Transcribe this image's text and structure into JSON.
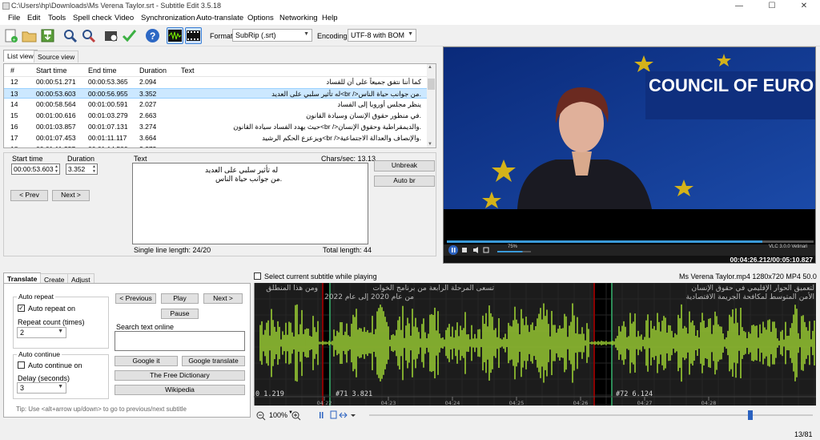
{
  "window": {
    "title": "C:\\Users\\hp\\Downloads\\Ms Verena Taylor.srt - Subtitle Edit 3.5.18",
    "minimize": "—",
    "maximize": "☐",
    "close": "✕"
  },
  "menu": [
    "File",
    "Edit",
    "Tools",
    "Spell check",
    "Video",
    "Synchronization",
    "Auto-translate",
    "Options",
    "Networking",
    "Help"
  ],
  "toolbar": {
    "format_label": "Format",
    "format_value": "SubRip (.srt)",
    "encoding_label": "Encoding",
    "encoding_value": "UTF-8 with BOM",
    "icons": [
      "new-file-icon",
      "open-folder-icon",
      "save-icon",
      "find-icon",
      "replace-icon",
      "visual-sync-icon",
      "spell-check-icon",
      "help-icon",
      "waveform-toggle-icon",
      "video-toggle-icon"
    ]
  },
  "list_tabs": [
    "List view",
    "Source view"
  ],
  "list": {
    "columns": [
      "#",
      "Start time",
      "End time",
      "Duration",
      "Text"
    ],
    "rows": [
      {
        "n": "12",
        "start": "00:00:51.271",
        "end": "00:00:53.365",
        "dur": "2.094",
        "text": "كما أننا نتفق جميعاً على أن للفساد"
      },
      {
        "n": "13",
        "start": "00:00:53.603",
        "end": "00:00:56.955",
        "dur": "3.352",
        "text": "له تأثير سلبي على العديد<br />من جوانب حياة الناس.",
        "selected": true
      },
      {
        "n": "14",
        "start": "00:00:58.564",
        "end": "00:01:00.591",
        "dur": "2.027",
        "text": "ينظر مجلس أوروبا إلى الفساد"
      },
      {
        "n": "15",
        "start": "00:01:00.616",
        "end": "00:01:03.279",
        "dur": "2.663",
        "text": "في منظور حقوق الإنسان وسيادة القانون."
      },
      {
        "n": "16",
        "start": "00:01:03.857",
        "end": "00:01:07.131",
        "dur": "3.274",
        "text": "حيث يهدد الفساد سيادة القانون<br />والديمقراطية وحقوق الإنسان."
      },
      {
        "n": "17",
        "start": "00:01:07.453",
        "end": "00:01:11.117",
        "dur": "3.664",
        "text": "ويزعزع الحكم الرشيد<br />والإنصاف والعدالة الاجتماعية."
      },
      {
        "n": "18",
        "start": "00:01:11.227",
        "end": "00:01:14.500",
        "dur": "3.273",
        "text": ""
      }
    ]
  },
  "edit": {
    "start_label": "Start time",
    "start_value": "00:00:53.603",
    "duration_label": "Duration",
    "duration_value": "3.352",
    "text_label": "Text",
    "chars_sec": "Chars/sec: 13.13",
    "text_line1": "له تأثير سلبي على العديد",
    "text_line2": "من جوانب حياة الناس.",
    "prev_btn": "< Prev",
    "next_btn": "Next >",
    "unbreak_btn": "Unbreak",
    "autobr_btn": "Auto br",
    "single_line": "Single line length: 24/20",
    "total_length": "Total length: 44"
  },
  "video": {
    "banner": "COUNCIL OF EURO",
    "vlc": "VLC 3.0.0 Vetinari",
    "volume": "75%",
    "position": "00:04:26.212",
    "duration": "00:05:10.827",
    "separator": "/",
    "progress": 0.86,
    "volume_level": 0.75
  },
  "bottom_tabs": [
    "Translate",
    "Create",
    "Adjust"
  ],
  "translate": {
    "auto_repeat_title": "Auto repeat",
    "auto_repeat_on": "Auto repeat on",
    "repeat_count_label": "Repeat count (times)",
    "repeat_count_value": "2",
    "auto_continue_title": "Auto continue",
    "auto_continue_on": "Auto continue on",
    "delay_label": "Delay (seconds)",
    "delay_value": "3",
    "previous_btn": "< Previous",
    "play_btn": "Play",
    "next_btn": "Next >",
    "pause_btn": "Pause",
    "search_label": "Search text online",
    "google_it": "Google it",
    "google_translate": "Google translate",
    "free_dictionary": "The Free Dictionary",
    "wikipedia": "Wikipedia",
    "tip": "Tip: Use <alt+arrow up/down> to go to previous/next subtitle"
  },
  "wave": {
    "select_checkbox": "Select current subtitle while playing",
    "media_info": "Ms Verena Taylor.mp4 1280x720 MP4 50.0",
    "text_a1": "ومن هذا المنطلق",
    "text_b1": "تسعى المرحلة الرابعة من برنامج الخوات",
    "text_b2": "من عام 2020 إلى عام 2022",
    "text_c1": "لتعميق الحوار الإقليمي في حقوق الإنسان",
    "text_c2": "الأمن المتوسط لمكافحة الجريمة الاقتصادية",
    "lbl_a": "0 1.219",
    "lbl_b": "#71  3.821",
    "lbl_c": "#72  6.124",
    "times": [
      "04:22",
      "04:23",
      "04:24",
      "04:25",
      "04:26",
      "04:27",
      "04:28"
    ],
    "zoom": "100%",
    "wave_color": "#9acd32"
  },
  "status": {
    "position": "13/81"
  }
}
